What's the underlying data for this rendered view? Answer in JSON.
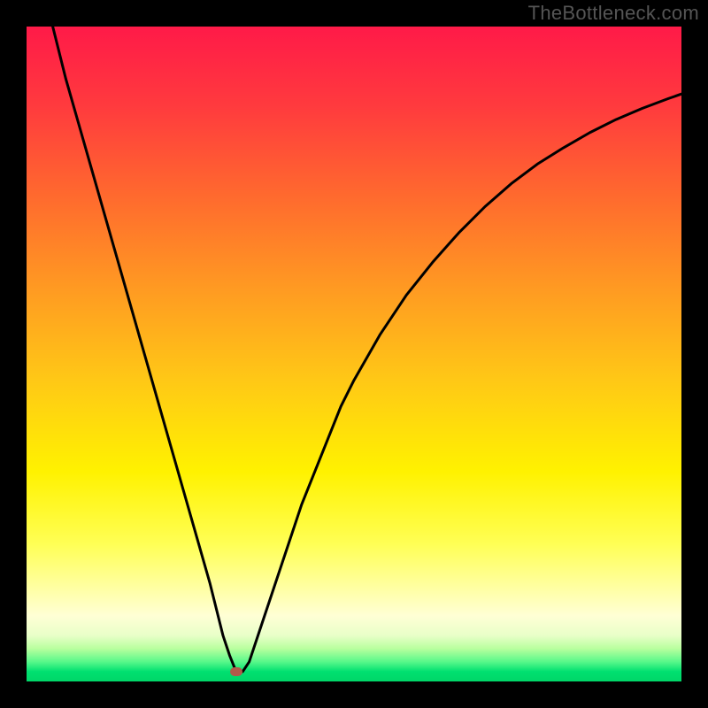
{
  "watermark": "TheBottleneck.com",
  "colors": {
    "frame_bg": "#000000",
    "watermark_text": "#555555",
    "curve_stroke": "#000000",
    "marker_fill": "#b35a4a",
    "gradient_top": "#ff1a48",
    "gradient_bottom": "#00d668"
  },
  "chart_data": {
    "type": "line",
    "title": "",
    "xlabel": "",
    "ylabel": "",
    "xlim": [
      0,
      100
    ],
    "ylim": [
      0,
      100
    ],
    "grid": false,
    "legend": false,
    "annotations": [
      "TheBottleneck.com"
    ],
    "marker": {
      "x": 32,
      "y": 1.5
    },
    "series": [
      {
        "name": "curve",
        "x": [
          4,
          6,
          8,
          10,
          12,
          14,
          16,
          18,
          20,
          22,
          24,
          26,
          28,
          29,
          30,
          31,
          32,
          33,
          34,
          36,
          38,
          40,
          42,
          44,
          46,
          48,
          50,
          54,
          58,
          62,
          66,
          70,
          74,
          78,
          82,
          86,
          90,
          94,
          98,
          100
        ],
        "y": [
          100,
          92,
          85,
          78,
          71,
          64,
          57,
          50,
          43,
          36,
          29,
          22,
          15,
          11,
          7,
          4,
          1.5,
          1.5,
          3,
          9,
          15,
          21,
          27,
          32,
          37,
          42,
          46,
          53,
          59,
          64,
          68.5,
          72.5,
          76,
          79,
          81.5,
          83.8,
          85.8,
          87.5,
          89,
          89.7
        ]
      }
    ]
  }
}
